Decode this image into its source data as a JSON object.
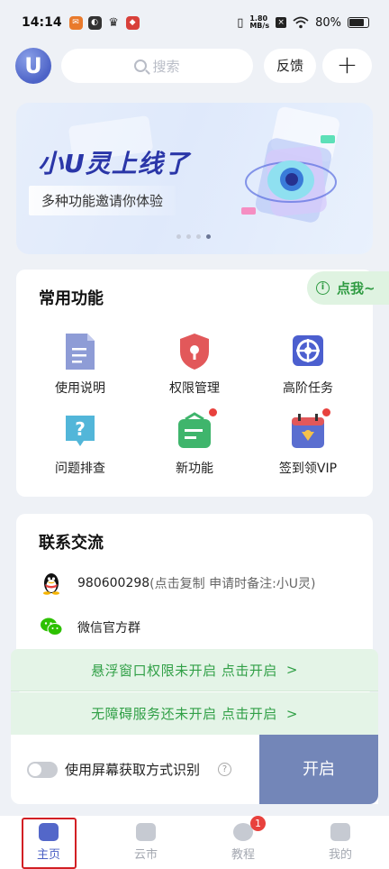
{
  "status_bar": {
    "time": "14:14",
    "net_speed_value": "1.80",
    "net_speed_unit": "MB/s",
    "battery": "80%"
  },
  "header": {
    "logo_letter": "U",
    "search_placeholder": "搜索",
    "feedback_label": "反馈",
    "add_label": "+"
  },
  "banner": {
    "title": "小U灵上线了",
    "subtitle": "多种功能邀请你体验",
    "dots_count": 4,
    "active_dot": 4
  },
  "common_functions": {
    "title": "常用功能",
    "tap_me": "点我~",
    "items": [
      {
        "label": "使用说明",
        "icon": "document-icon",
        "color": "#8e9cd6"
      },
      {
        "label": "权限管理",
        "icon": "shield-lock-icon",
        "color": "#e2585a"
      },
      {
        "label": "高阶任务",
        "icon": "target-icon",
        "color": "#4c5fcf"
      },
      {
        "label": "问题排查",
        "icon": "question-chat-icon",
        "color": "#52b6d9"
      },
      {
        "label": "新功能",
        "icon": "new-feature-icon",
        "color": "#3fb56c"
      },
      {
        "label": "签到领VIP",
        "icon": "calendar-vip-icon",
        "color": "#5a6ed0"
      }
    ]
  },
  "contact": {
    "title": "联系交流",
    "qq_number": "980600298",
    "qq_hint": "(点击复制 申请时备注:小U灵)",
    "wechat_label": "微信官方群"
  },
  "warnings": {
    "float_window": "悬浮窗口权限未开启 点击开启",
    "accessibility": "无障碍服务还未开启 点击开启",
    "chevron": ">"
  },
  "start_panel": {
    "toggle_label": "使用屏幕获取方式识别",
    "help": "?",
    "start_button": "开启"
  },
  "bottom_nav": [
    {
      "label": "主页",
      "icon": "home-icon",
      "active": true
    },
    {
      "label": "云市",
      "icon": "store-icon",
      "active": false
    },
    {
      "label": "教程",
      "icon": "chat-bubbles-icon",
      "active": false,
      "badge": "1"
    },
    {
      "label": "我的",
      "icon": "profile-icon",
      "active": false
    }
  ]
}
